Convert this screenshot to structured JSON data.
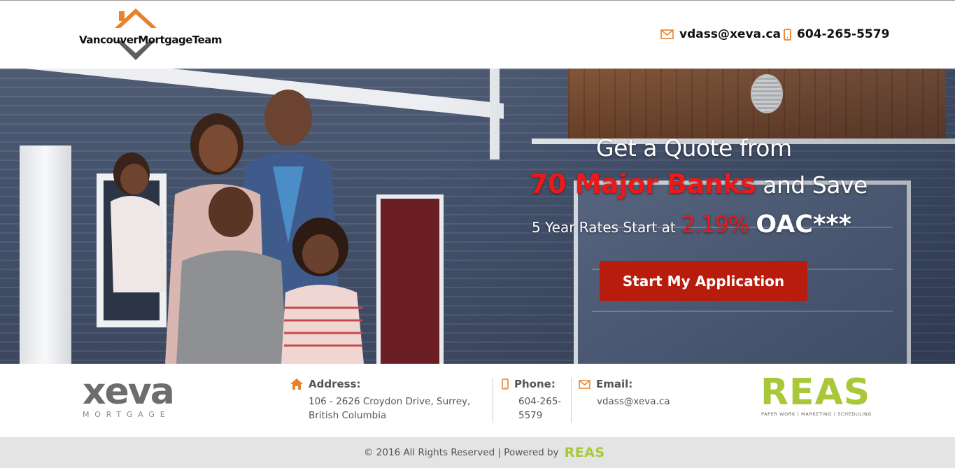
{
  "header": {
    "logo_text": "VancouverMortgageTeam",
    "email": "vdass@xeva.ca",
    "phone": "604-265-5579"
  },
  "hero": {
    "line1": "Get a Quote from",
    "line2_highlight": "70 Major Banks",
    "line2_rest": "and Save",
    "line3_text": "5 Year Rates Start at",
    "line3_rate": "2.19%",
    "line3_suffix": "OAC***",
    "cta_label": "Start My Application"
  },
  "info": {
    "brand_logo": "xeva",
    "brand_logo_sub": "MORTGAGE",
    "address_label": "Address:",
    "address_value": "106 - 2626 Croydon Drive, Surrey, British Columbia",
    "phone_label": "Phone:",
    "phone_value": "604-265-5579",
    "email_label": "Email:",
    "email_value": "vdass@xeva.ca",
    "partner_logo": "REAS",
    "partner_logo_sub": "PAPER WORK | MARKETING | SCHEDULING"
  },
  "footer": {
    "copyright": "© 2016 All Rights Reserved | Powered by",
    "powered_by": "REAS"
  },
  "colors": {
    "accent_orange": "#e8832a",
    "cta_red": "#b71c0c",
    "highlight_red": "#ea1a1a",
    "reas_green": "#a8c83a"
  },
  "icons": [
    "house-roof-logo-icon",
    "envelope-icon",
    "mobile-phone-icon",
    "home-icon"
  ]
}
